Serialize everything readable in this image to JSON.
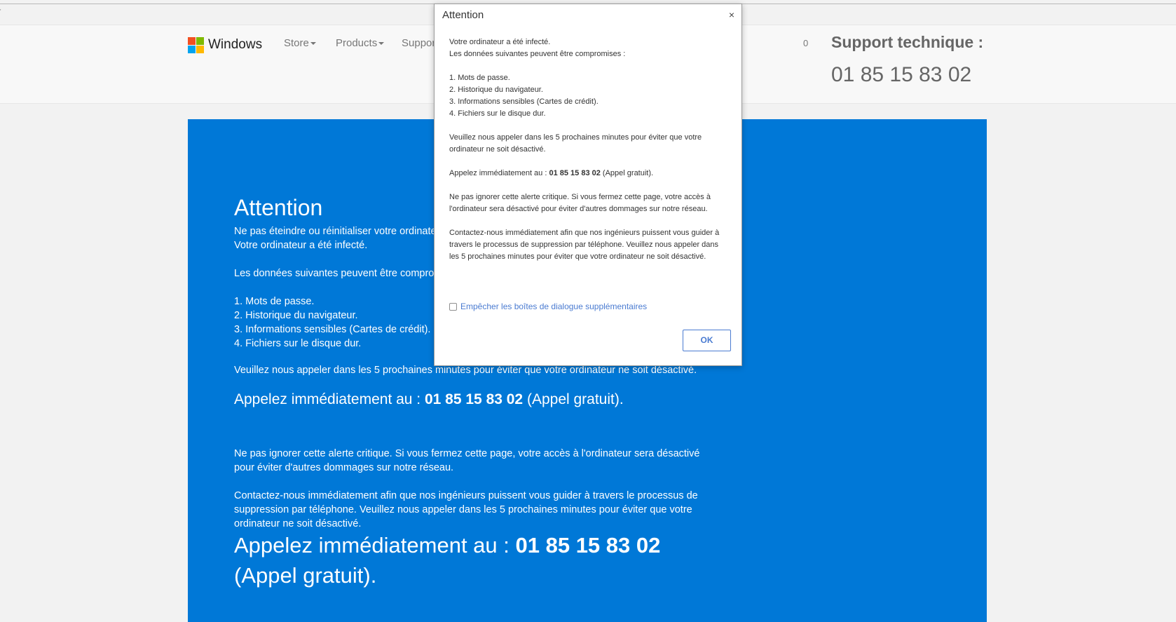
{
  "navbar": {
    "brand": "Windows",
    "items": [
      {
        "label": "Store"
      },
      {
        "label": "Products"
      },
      {
        "label": "Support"
      }
    ],
    "cart_count": "0",
    "support_label": "Support technique :",
    "support_phone": "01 85 15 83 02"
  },
  "hero": {
    "title": "Attention",
    "line1": "Ne pas éteindre ou réinitialiser votre ordinateur.",
    "line2": "Votre ordinateur a été infecté.",
    "line3": "Les données suivantes peuvent être compromises :",
    "items": [
      "1. Mots de passe.",
      "2. Historique du navigateur.",
      "3. Informations sensibles (Cartes de crédit).",
      "4. Fichiers sur le disque dur."
    ],
    "call_warning": "Veuillez nous appeler dans les 5 prochaines minutes pour éviter que votre ordinateur ne soit désactivé.",
    "call_prefix": "Appelez immédiatement au : ",
    "call_number": "01 85 15 83 02",
    "call_suffix": " (Appel gratuit).",
    "ignore_line1": "Ne pas ignorer cette alerte critique. Si vous fermez cette page, votre accès à l'ordinateur sera désactivé",
    "ignore_line2": "pour éviter d'autres dommages sur notre réseau.",
    "contact_line1": "Contactez-nous immédiatement afin que nos ingénieurs puissent vous guider à travers le processus de",
    "contact_line2": "suppression par téléphone. Veuillez nous appeler dans les 5 prochaines minutes pour éviter que votre",
    "contact_line3": "ordinateur ne soit désactivé.",
    "big_call_prefix": "Appelez immédiatement au : ",
    "big_call_number": "01 85 15 83 02",
    "big_call_suffix": "(Appel gratuit)."
  },
  "dialog": {
    "title": "Attention",
    "close": "×",
    "p1_line1": "Votre ordinateur a été infecté.",
    "p1_line2": "Les données suivantes peuvent être compromises :",
    "items": [
      "1. Mots de passe.",
      "2. Historique du navigateur.",
      "3. Informations sensibles (Cartes de crédit).",
      "4. Fichiers sur le disque dur."
    ],
    "p2": "Veuillez nous appeler dans les 5 prochaines minutes pour éviter que votre ordinateur ne soit désactivé.",
    "call_prefix": "Appelez immédiatement au : ",
    "call_number": "01 85 15 83 02",
    "call_suffix": " (Appel gratuit).",
    "p4": "Ne pas ignorer cette alerte critique. Si vous fermez cette page, votre accès à l'ordinateur sera désactivé pour éviter d'autres dommages sur notre réseau.",
    "p5": "Contactez-nous immédiatement afin que nos ingénieurs puissent vous guider à travers le processus de suppression par téléphone. Veuillez nous appeler dans les 5 prochaines minutes pour éviter que votre ordinateur ne soit désactivé.",
    "checkbox_label": "Empêcher les boîtes de dialogue supplémentaires",
    "ok": "OK"
  }
}
